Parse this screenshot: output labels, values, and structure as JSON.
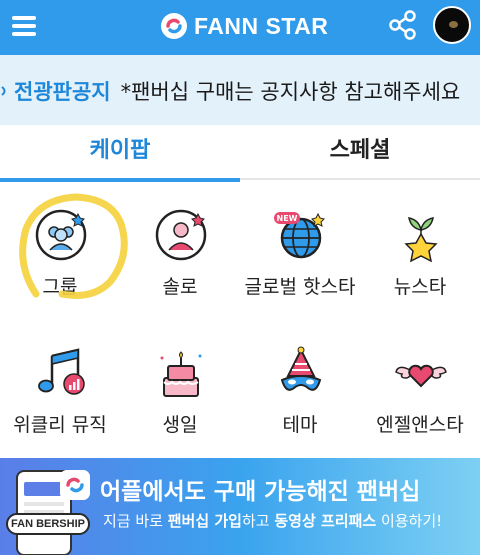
{
  "header": {
    "brand": "FANN STAR",
    "menu_icon": "hamburger-icon",
    "share_icon": "share-icon",
    "accent_color": "#2f9bea"
  },
  "notice": {
    "title": "전광판공지",
    "text": "*팬버십 구매는 공지사항 참고해주세요"
  },
  "tabs": [
    {
      "label": "케이팝",
      "active": true
    },
    {
      "label": "스페셜",
      "active": false
    }
  ],
  "categories": [
    {
      "label": "그룹",
      "icon": "group-icon"
    },
    {
      "label": "솔로",
      "icon": "solo-icon"
    },
    {
      "label": "글로벌 핫스타",
      "icon": "globe-icon",
      "badge": "NEW"
    },
    {
      "label": "뉴스타",
      "icon": "new-star-icon"
    },
    {
      "label": "위클리 뮤직",
      "icon": "music-note-icon"
    },
    {
      "label": "생일",
      "icon": "cake-icon"
    },
    {
      "label": "테마",
      "icon": "party-hat-icon"
    },
    {
      "label": "엔젤앤스타",
      "icon": "winged-heart-icon"
    }
  ],
  "banner": {
    "title": "어플에서도 구매 가능해진 팬버십",
    "sub_prefix": "지금 바로 ",
    "sub_bold1": "팬버십 가입",
    "sub_mid": "하고 ",
    "sub_bold2": "동영상 프리패스",
    "sub_suffix": " 이용하기!",
    "badge": "FAN BERSHIP"
  }
}
